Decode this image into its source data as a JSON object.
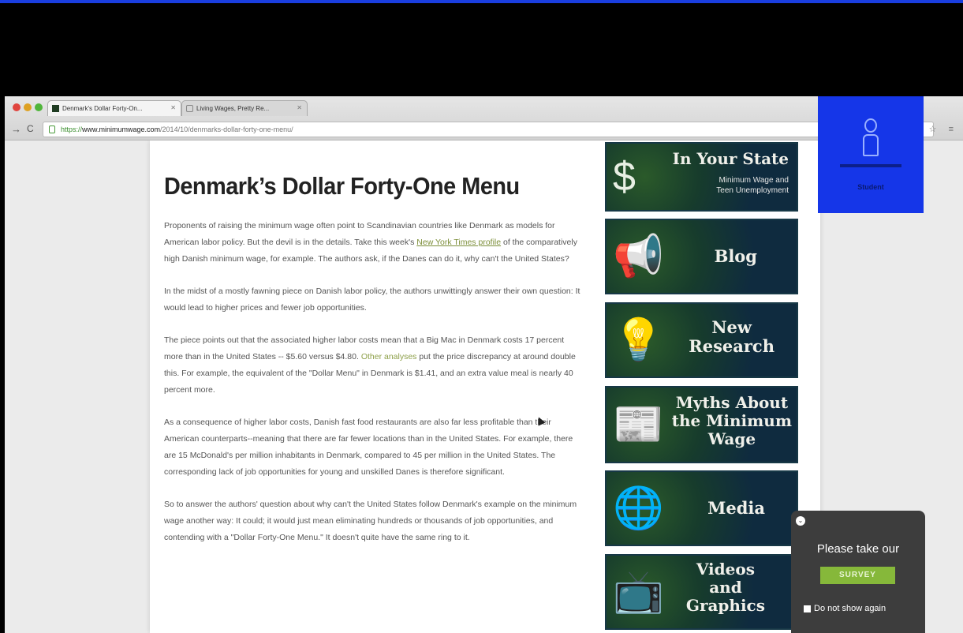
{
  "browser": {
    "tabs": [
      {
        "label": "Denmark's Dollar Forty-On..."
      },
      {
        "label": "Living Wages, Pretty Re..."
      }
    ],
    "url": {
      "scheme": "https://",
      "domain": "www.minimumwage.com",
      "path": "/2014/10/denmarks-dollar-forty-one-menu/"
    }
  },
  "article": {
    "title": "Denmark’s Dollar Forty-One Menu",
    "p1_before": "Proponents of raising the minimum wage often point to Scandinavian countries like Denmark as models for American labor policy. But the devil is in the details. Take this week's ",
    "p1_link": "New York Times profile",
    "p1_after": " of the comparatively high Danish minimum wage, for example. The authors ask, if the Danes can do it, why can't the United States?",
    "p2": "In the midst of a mostly fawning piece on Danish labor policy, the authors unwittingly answer their own question: It would lead to higher prices and fewer job opportunities.",
    "p3_before": "The piece points out that the associated higher labor costs mean that a Big Mac in Denmark costs 17 percent more than in the United States -- $5.60 versus $4.80. ",
    "p3_link": "Other analyses",
    "p3_after": " put the price discrepancy at around double this. For example, the equivalent of the \"Dollar Menu\" in Denmark is $1.41, and an extra value meal is nearly 40 percent more.",
    "p4": "As a consequence of higher labor costs, Danish fast food restaurants are also far less profitable than their American counterparts--meaning that there are far fewer locations than in the United States. For example, there are 15 McDonald's per million inhabitants in Denmark, compared to 45 per million in the United States. The corresponding lack of job opportunities for young and unskilled Danes is therefore significant.",
    "p5": "So to answer the authors' question about why can't the United States follow Denmark's example on the minimum wage another way: It could; it would just mean eliminating hundreds or thousands of job opportunities, and contending with a \"Dollar Forty-One Menu.\" It doesn't quite have the same ring to it."
  },
  "sidebar": {
    "state_title": "In Your State",
    "state_sub1": "Minimum Wage and",
    "state_sub2": "Teen Unemployment",
    "blog": "Blog",
    "research1": "New",
    "research2": "Research",
    "myths1": "Myths About",
    "myths2": "the Minimum",
    "myths3": "Wage",
    "media": "Media",
    "videos1": "Videos",
    "videos2": "and",
    "videos3": "Graphics"
  },
  "overlay": {
    "label": "Student"
  },
  "survey": {
    "prompt": "Please take our",
    "button": "SURVEY",
    "checkbox_label": "Do not show again"
  }
}
